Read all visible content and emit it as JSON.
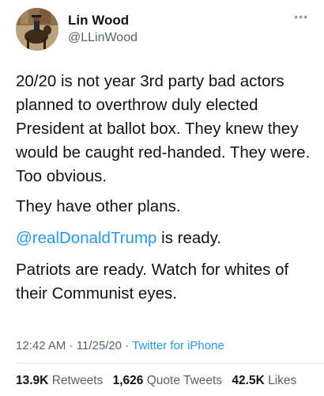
{
  "header": {
    "display_name": "Lin Wood",
    "handle": "@LLinWood",
    "more_icon": "more-horizontal-icon"
  },
  "tweet": {
    "para1": "20/20 is not year 3rd party bad actors planned to overthrow duly elected President at ballot box. They knew they would be caught red-handed. They were. Too obvious.",
    "para2": "They have other plans.",
    "mention": "@realDonaldTrump",
    "para3_rest": " is ready.",
    "para4": "Patriots are ready. Watch for whites of their Communist eyes."
  },
  "meta": {
    "time": "12:42 AM",
    "sep1": " · ",
    "date": "11/25/20",
    "sep2": " · ",
    "source": "Twitter for iPhone"
  },
  "stats": {
    "retweets_count": "13.9K",
    "retweets_label": "Retweets",
    "quote_count": "1,626",
    "quote_label": "Quote Tweets",
    "likes_count": "42.5K",
    "likes_label": "Likes"
  },
  "colors": {
    "link": "#1d9bf0",
    "secondary_text": "#536471",
    "primary_text": "#0f1419"
  }
}
